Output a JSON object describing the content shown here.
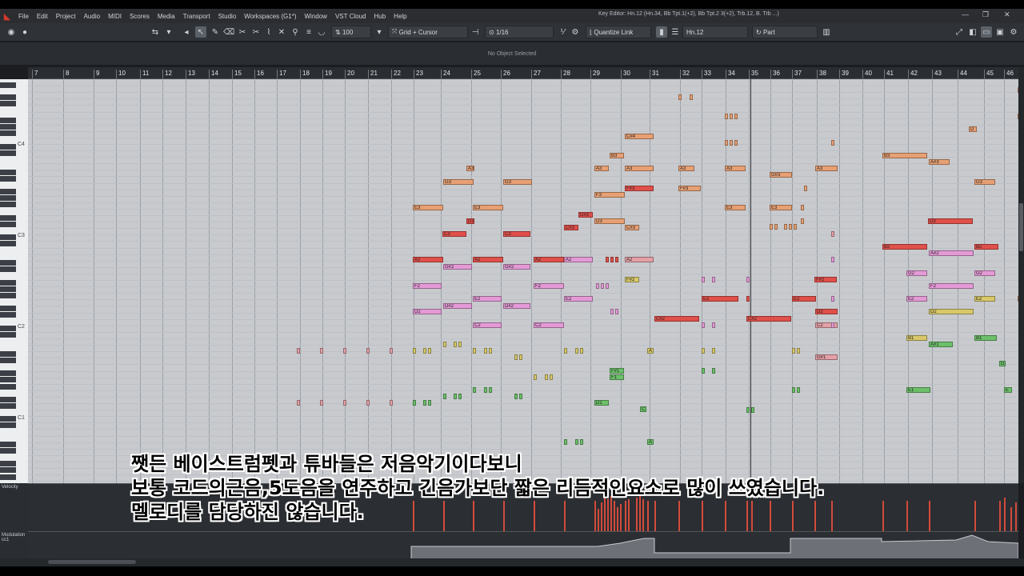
{
  "menu": [
    "File",
    "Edit",
    "Project",
    "Audio",
    "MIDI",
    "Scores",
    "Media",
    "Transport",
    "Studio",
    "Workspaces (G1*)",
    "Window",
    "VST Cloud",
    "Hub",
    "Help"
  ],
  "window_title": "Key Editor: Hn.12 (Hn.34, Bb Tpt.1(+2), Bb Tpt.2 3(+2), Trb.12, B. Trb ...)",
  "toolbar": {
    "velocity": "100",
    "snap_mode": "Grid + Cursor",
    "quantize": "1/16",
    "quantize_link": "Quantize Link",
    "track": "Hn.12",
    "part": "Part"
  },
  "info_line": "No Object Selected",
  "ruler_bars": [
    "7",
    "8",
    "9",
    "10",
    "11",
    "12",
    "13",
    "14",
    "15",
    "16",
    "17",
    "18",
    "19",
    "20",
    "21",
    "22",
    "23",
    "24",
    "25",
    "26",
    "27",
    "28",
    "29",
    "30",
    "31",
    "32",
    "33",
    "34",
    "35",
    "36",
    "37",
    "38",
    "39",
    "40",
    "41",
    "42",
    "43",
    "44",
    "45",
    "46"
  ],
  "octave_labels": [
    "C4",
    "C3",
    "C2",
    "C1"
  ],
  "lanes": {
    "velocity": "Velocity",
    "modulation": "Modulation",
    "cc": "cc1"
  },
  "subtitle": {
    "line1": "쨋든 베이스트럼펫과 튜바들은 저음악기이다보니",
    "line2": "보통 코드의근음,5도음을 연주하고 긴음가보단 짧은 리듬적인요소로 많이 쓰였습니다.",
    "line3": "멜로디를 담당하진 않습니다."
  },
  "notes": [
    {
      "t": "A2",
      "c": "red"
    },
    {
      "t": "E3",
      "c": "ora"
    },
    {
      "t": "F2",
      "c": "pnk"
    },
    {
      "t": "D2",
      "c": "pnk"
    },
    {
      "t": "G3",
      "c": "ora"
    },
    {
      "t": "G#2",
      "c": "pnk"
    },
    {
      "t": "D#2",
      "c": "pnk"
    },
    {
      "t": "A3",
      "c": "ora"
    },
    {
      "t": "C3",
      "c": "red"
    },
    {
      "t": "D3",
      "c": "red"
    },
    {
      "t": "A2",
      "c": "red"
    },
    {
      "t": "E3",
      "c": "ora"
    },
    {
      "t": "E2",
      "c": "pnk"
    },
    {
      "t": "C2",
      "c": "pnk"
    },
    {
      "t": "G3",
      "c": "ora"
    },
    {
      "t": "C3",
      "c": "red"
    },
    {
      "t": "G#2",
      "c": "pnk"
    },
    {
      "t": "D#2",
      "c": "pnk"
    },
    {
      "t": "A2",
      "c": "red"
    },
    {
      "t": "F2",
      "c": "pnk"
    },
    {
      "t": "C2",
      "c": "pnk"
    },
    {
      "t": "A2",
      "c": "pnk"
    },
    {
      "t": "E2",
      "c": "pnk"
    },
    {
      "t": "C#3",
      "c": "red"
    },
    {
      "t": "D#3",
      "c": "red"
    },
    {
      "t": "A3",
      "c": "ora"
    },
    {
      "t": "F3",
      "c": "ora"
    },
    {
      "t": "D3",
      "c": "ora"
    },
    {
      "t": "B3",
      "c": "ora"
    },
    {
      "t": "C#4",
      "c": "ora"
    },
    {
      "t": "A3",
      "c": "ora"
    },
    {
      "t": "F#3",
      "c": "red"
    },
    {
      "t": "C#3",
      "c": "ora"
    },
    {
      "t": "A2",
      "c": "ros"
    },
    {
      "t": "F#2",
      "c": "yel"
    },
    {
      "t": "C#2",
      "c": "red"
    },
    {
      "t": "F#1",
      "c": "grn"
    },
    {
      "t": "F1",
      "c": "grn"
    },
    {
      "t": "D1",
      "c": "grn"
    },
    {
      "t": "C",
      "c": "grn"
    },
    {
      "t": "A",
      "c": "grn"
    },
    {
      "t": "A",
      "c": "yel"
    },
    {
      "t": "A3",
      "c": "ora"
    },
    {
      "t": "F#3",
      "c": "ora"
    },
    {
      "t": "E2",
      "c": "red"
    },
    {
      "t": "A3",
      "c": "ora"
    },
    {
      "t": "E3",
      "c": "ora"
    },
    {
      "t": "G#3",
      "c": "ora"
    },
    {
      "t": "E3",
      "c": "ora"
    },
    {
      "t": "C#2",
      "c": "red"
    },
    {
      "t": "E2",
      "c": "red"
    },
    {
      "t": "F#2",
      "c": "red"
    },
    {
      "t": "D2",
      "c": "red"
    },
    {
      "t": "C2",
      "c": "ros"
    },
    {
      "t": "G#1",
      "c": "ros"
    },
    {
      "t": "A3",
      "c": "ora"
    },
    {
      "t": "B3",
      "c": "ora"
    },
    {
      "t": "B2",
      "c": "red"
    },
    {
      "t": "G2",
      "c": "pnk"
    },
    {
      "t": "E2",
      "c": "pnk"
    },
    {
      "t": "B1",
      "c": "yel"
    },
    {
      "t": "E1",
      "c": "grn"
    },
    {
      "t": "A#3",
      "c": "ora"
    },
    {
      "t": "D3",
      "c": "red"
    },
    {
      "t": "A#2",
      "c": "pnk"
    },
    {
      "t": "F2",
      "c": "pnk"
    },
    {
      "t": "D2",
      "c": "yel"
    },
    {
      "t": "A#1",
      "c": "grn"
    },
    {
      "t": "G3",
      "c": "ora"
    },
    {
      "t": "B2",
      "c": "red"
    },
    {
      "t": "G2",
      "c": "pnk"
    },
    {
      "t": "E2",
      "c": "yel"
    },
    {
      "t": "B1",
      "c": "grn"
    },
    {
      "t": "G",
      "c": "grn"
    },
    {
      "t": "E",
      "c": "grn"
    },
    {
      "t": "D",
      "c": "ora"
    }
  ]
}
